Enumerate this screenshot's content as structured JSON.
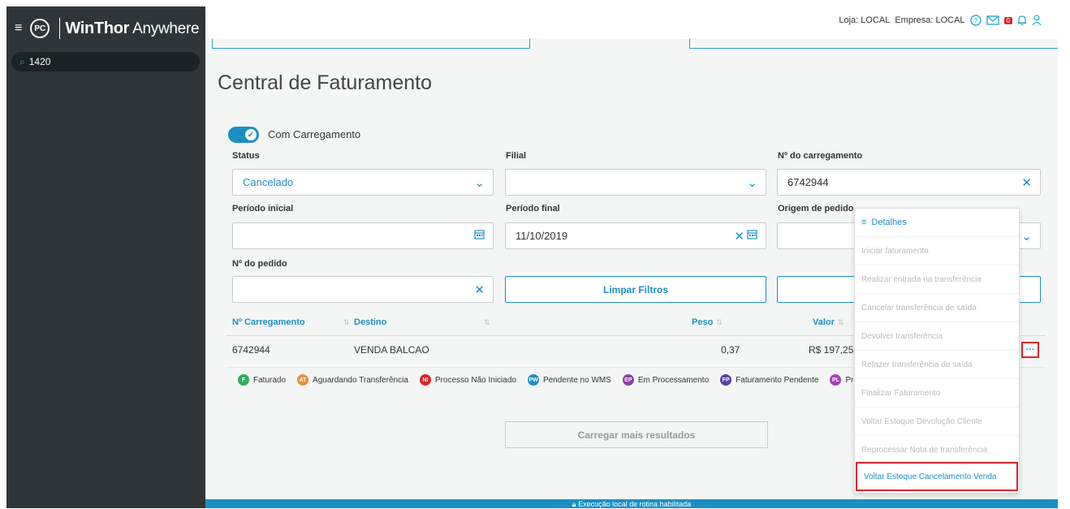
{
  "app": {
    "brand_logo": "PC",
    "brand_bold": "WinThor",
    "brand_light": "Anywhere",
    "search_value": "1420"
  },
  "header": {
    "loja": "Loja: LOCAL",
    "empresa": "Empresa: LOCAL",
    "mail_count": "0",
    "icons": [
      "help-icon",
      "mail-icon",
      "bell-icon",
      "user-icon"
    ]
  },
  "page": {
    "title": "Central de Faturamento",
    "toggle_label": "Com Carregamento",
    "toggle_on": true
  },
  "filters": {
    "status_label": "Status",
    "status_value": "Cancelado",
    "filial_label": "Filial",
    "filial_value": "",
    "carregamento_label": "Nº do carregamento",
    "carregamento_value": "6742944",
    "periodo_inicial_label": "Período inicial",
    "periodo_inicial_value": "",
    "periodo_final_label": "Período final",
    "periodo_final_value": "11/10/2019",
    "origem_label": "Origem de pedido",
    "pedido_label": "Nº do pedido",
    "pedido_value": "",
    "limpar_label": "Limpar Filtros"
  },
  "table": {
    "headers": [
      "Nº Carregamento",
      "Destino",
      "Peso",
      "Valor"
    ],
    "rows": [
      {
        "carregamento": "6742944",
        "destino": "VENDA BALCAO",
        "peso": "0,37",
        "valor": "R$ 197,25"
      }
    ],
    "more_label": "···"
  },
  "legend": [
    {
      "code": "F",
      "label": "Faturado",
      "color": "#2eae5b"
    },
    {
      "code": "AT",
      "label": "Aguardando Transferência",
      "color": "#e8903a"
    },
    {
      "code": "NI",
      "label": "Processo Não Iniciado",
      "color": "#d9262c"
    },
    {
      "code": "PW",
      "label": "Pendente no WMS",
      "color": "#1b8fc2"
    },
    {
      "code": "EP",
      "label": "Em Processamento",
      "color": "#8b3fa8"
    },
    {
      "code": "FP",
      "label": "Faturamento Pendente",
      "color": "#5a3fa8"
    },
    {
      "code": "PL",
      "label": "Pr",
      "color": "#a83fb8"
    }
  ],
  "load_more_label": "Carregar mais resultados",
  "bottom_bar_text": "Execução local de rotina habilitada",
  "menu": {
    "items": [
      "Detalhes",
      "Iniciar faturamento",
      "Realizar entrada na transferência",
      "Cancelar transferência de saída",
      "Devolver transferência",
      "Refazer transferência de saída",
      "Finalizar Faturamento",
      "Voltar Estoque Devolução Cliente",
      "Reprocessar Nota de transferência",
      "Voltar Estoque Cancelamento Venda"
    ]
  }
}
